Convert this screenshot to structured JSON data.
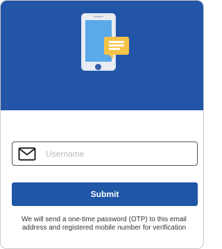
{
  "colors": {
    "hero_background": "#2255a8",
    "accent": "#1f56a6",
    "bubble": "#f6c347"
  },
  "icons": {
    "illustration": "phone-message-illustration",
    "input_icon": "mail-icon"
  },
  "form": {
    "username_placeholder": "Username",
    "username_value": "",
    "submit_label": "Submit"
  },
  "footer": {
    "note": "We will send a one-time password (OTP) to this email address and registered mobile number for verification"
  }
}
